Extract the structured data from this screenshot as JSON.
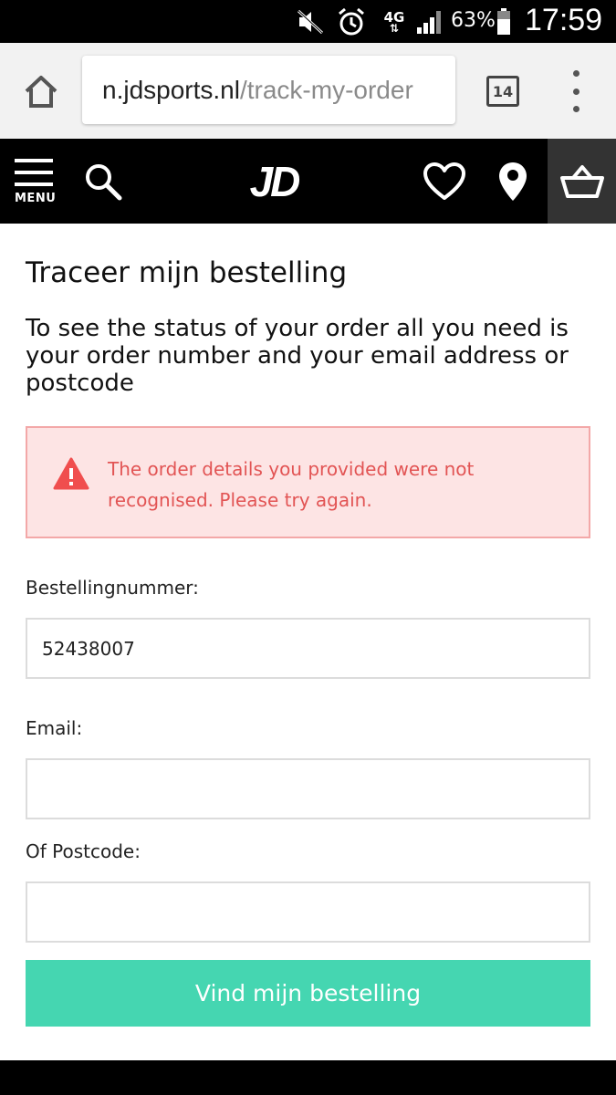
{
  "status_bar": {
    "network": "4G",
    "battery_percent": "63%",
    "time": "17:59",
    "icons": [
      "mute-icon",
      "alarm-icon",
      "network-4g-icon",
      "signal-icon",
      "battery-icon"
    ]
  },
  "browser": {
    "url_host": "n.jdsports.nl",
    "url_path": "/track-my-order",
    "tab_count": "14",
    "icons": [
      "home-icon",
      "tabs-icon",
      "overflow-menu-icon"
    ]
  },
  "header": {
    "menu_label": "MENU",
    "logo_text": "JD",
    "icons": [
      "hamburger-icon",
      "search-icon",
      "heart-icon",
      "location-pin-icon",
      "basket-icon"
    ]
  },
  "page": {
    "title": "Traceer mijn bestelling",
    "intro": "To see the status of your order all you need is your order number and your email address or postcode",
    "alert": {
      "message": "The order details you provided were not recognised. Please try again.",
      "icon": "warning-icon"
    },
    "form": {
      "order_number_label": "Bestellingnummer:",
      "order_number_value": "52438007",
      "email_label": "Email:",
      "email_value": "",
      "postcode_label": "Of Postcode:",
      "postcode_value": "",
      "submit_label": "Vind mijn bestelling"
    }
  },
  "colors": {
    "accent": "#45d6b1",
    "alert_bg": "#fde4e4",
    "alert_border": "#f3a8a8",
    "alert_text": "#e25454"
  }
}
